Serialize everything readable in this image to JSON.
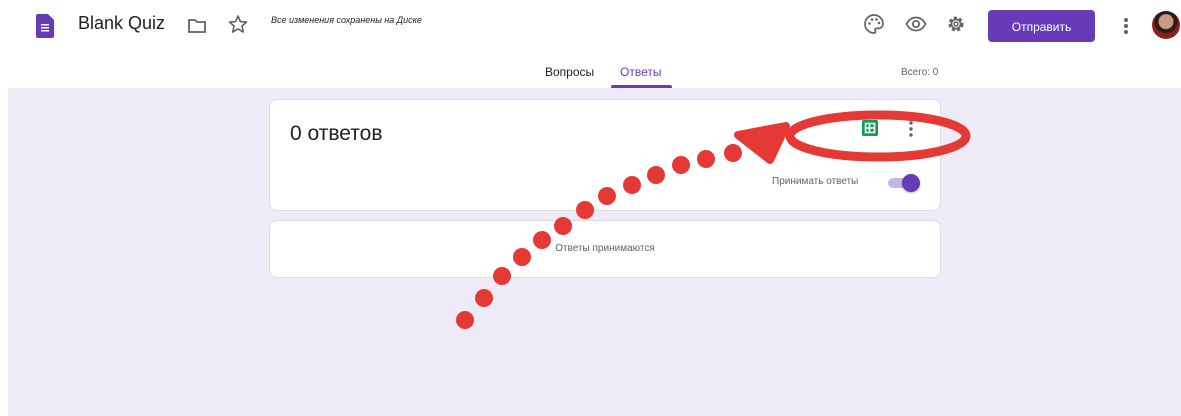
{
  "header": {
    "app_icon": "forms-icon",
    "title": "Blank Quiz",
    "save_status": "Все изменения сохранены на Диске",
    "send_label": "Отправить",
    "icons": [
      "folder-icon",
      "star-icon",
      "palette-icon",
      "eye-icon",
      "gear-icon",
      "more-vert-icon",
      "avatar"
    ]
  },
  "tabs": {
    "questions": "Вопросы",
    "responses": "Ответы",
    "total": "Всего: 0"
  },
  "responses_card": {
    "count_label": "0 ответов",
    "accept_label": "Принимать ответы",
    "accepting": true,
    "icons": [
      "sheets-icon",
      "more-vert-icon"
    ]
  },
  "status_card": {
    "text": "Ответы принимаются"
  },
  "colors": {
    "accent": "#673ab7",
    "background": "#f0ebf8",
    "sheets": "#0f9d58",
    "annotation": "#e53935"
  }
}
